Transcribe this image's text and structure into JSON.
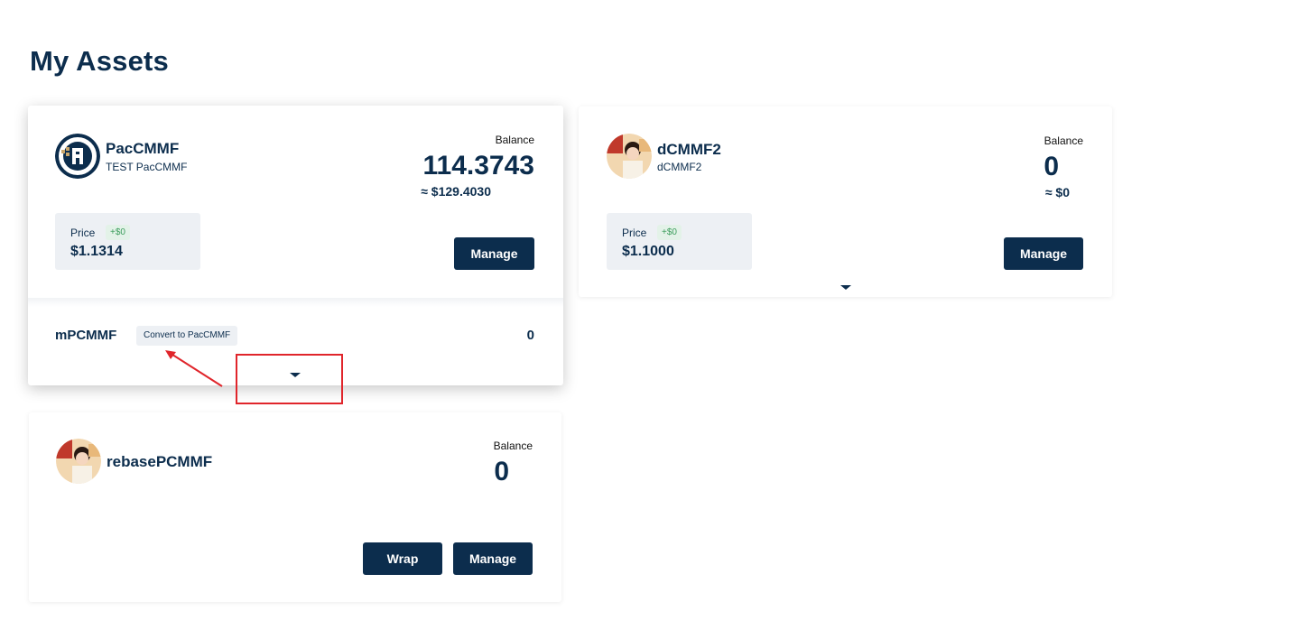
{
  "page": {
    "title": "My Assets"
  },
  "colors": {
    "primary": "#0c2d4d",
    "badge_green": "#3c9d5c",
    "annotation_red": "#e0252b"
  },
  "assets": [
    {
      "name": "PacCMMF",
      "subtitle": "TEST PacCMMF",
      "icon": "paccmmf-logo-icon",
      "balance_label": "Balance",
      "balance": "114.3743",
      "balance_usd": "≈ $129.4030",
      "price_label": "Price",
      "price_change": "+$0",
      "price": "$1.1314",
      "manage_label": "Manage",
      "sub_token": {
        "name": "mPCMMF",
        "convert_label": "Convert to PacCMMF",
        "balance": "0"
      }
    },
    {
      "name": "dCMMF2",
      "subtitle": "dCMMF2",
      "icon": "token-avatar-icon",
      "balance_label": "Balance",
      "balance": "0",
      "balance_usd": "≈ $0",
      "price_label": "Price",
      "price_change": "+$0",
      "price": "$1.1000",
      "manage_label": "Manage"
    },
    {
      "name": "rebasePCMMF",
      "icon": "token-avatar-icon",
      "balance_label": "Balance",
      "balance": "0",
      "wrap_label": "Wrap",
      "manage_label": "Manage"
    }
  ]
}
